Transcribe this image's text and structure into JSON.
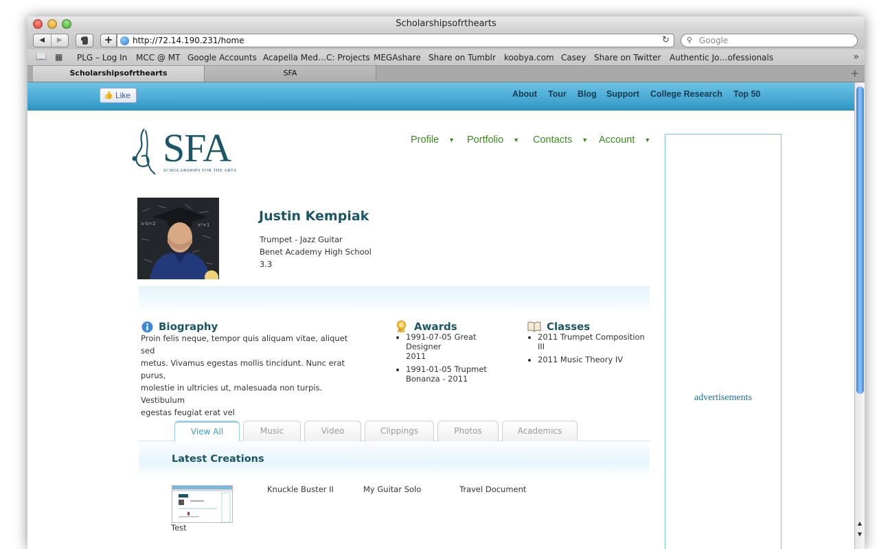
{
  "window": {
    "title": "Scholarshipsofrthearts"
  },
  "toolbar": {
    "url": "http://72.14.190.231/home",
    "search_placeholder": "Google",
    "back_label": "◀",
    "forward_label": "▶",
    "add_label": "+",
    "reload_label": "↻"
  },
  "bookmarks": [
    "PLG – Log In",
    "MCC @ MT",
    "Google Accounts",
    "Acapella Med…C: Projects",
    "MEGAshare",
    "Share on Tumblr",
    "koobya.com",
    "Casey",
    "Share on Twitter",
    "Authentic Jo…ofessionals"
  ],
  "bookmarks_more": "»",
  "tabs": [
    {
      "label": "Scholarshipsofrthearts",
      "active": true
    },
    {
      "label": "SFA",
      "active": false
    }
  ],
  "tab_add": "+",
  "site": {
    "like_label": "Like",
    "top_nav": [
      "About",
      "Tour",
      "Blog",
      "Support",
      "College Research",
      "Top 50"
    ],
    "logo_text": "SFA",
    "logo_subtitle": "SCHOLARSHIPS FOR THE ARTS",
    "main_nav": [
      "Profile",
      "Portfolio",
      "Contacts",
      "Account"
    ],
    "ad_label": "advertisements"
  },
  "profile": {
    "name": "Justin Kempiak",
    "instrument": "Trumpet - Jazz Guitar",
    "school": "Benet Academy High School",
    "gpa": "3.3"
  },
  "sections": {
    "biography": {
      "title": "Biography",
      "lines": [
        "Proin felis neque, tempor quis aliquam vitae, aliquet sed",
        "metus. Vivamus egestas mollis tincidunt. Nunc erat purus,",
        "molestie in ultricies ut, malesuada non turpis. Vestibulum",
        "egestas feugiat erat vel"
      ]
    },
    "awards": {
      "title": "Awards",
      "items": [
        [
          "1991-07-05 Great Designer",
          "2011"
        ],
        [
          "1991-01-05 Trupmet",
          "Bonanza - 2011"
        ]
      ]
    },
    "classes": {
      "title": "Classes",
      "items": [
        [
          "2011 Trumpet Composition",
          "III"
        ],
        [
          "2011 Music Theory IV"
        ]
      ]
    }
  },
  "content_tabs": [
    "View All",
    "Music",
    "Video",
    "Clippings",
    "Photos",
    "Academics"
  ],
  "latest": {
    "title": "Latest Creations",
    "items": [
      "Test",
      "Knuckle Buster II",
      "My Guitar Solo",
      "Travel Document"
    ]
  },
  "colors": {
    "brand": "#1a5568",
    "nav_green": "#3a8a1e",
    "header_blue": "#2f97c6",
    "tab_active": "#3aa0c8"
  }
}
